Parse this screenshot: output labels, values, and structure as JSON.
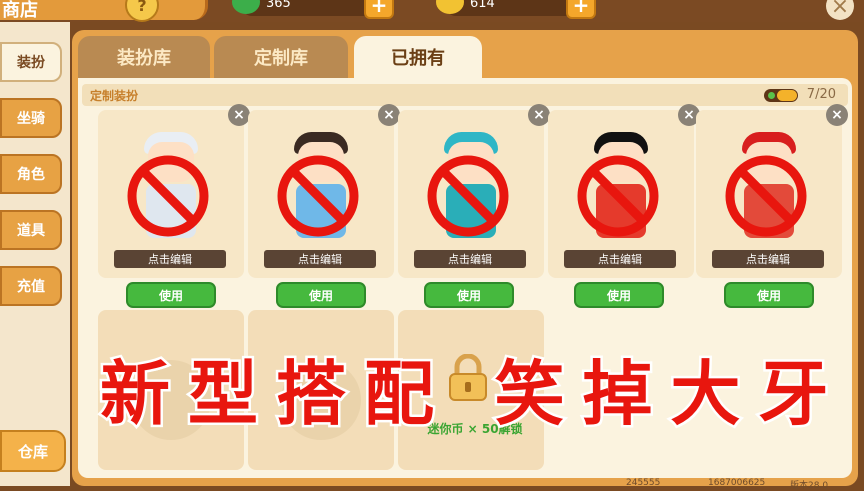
{
  "topbar": {
    "title": "商店",
    "help_icon": "?",
    "currencies": [
      {
        "name": "green-gem",
        "value": "365",
        "color": "#3cae4a"
      },
      {
        "name": "gold-coin",
        "value": "614",
        "color": "#f2c232"
      }
    ],
    "plus_label": "+",
    "close_label": "×"
  },
  "sidebar": {
    "items": [
      {
        "label": "装扮",
        "active": true
      },
      {
        "label": "坐骑",
        "active": false
      },
      {
        "label": "角色",
        "active": false
      },
      {
        "label": "道具",
        "active": false
      },
      {
        "label": "充值",
        "active": false
      }
    ],
    "warehouse_label": "仓库"
  },
  "tabs": [
    {
      "label": "装扮库",
      "active": false
    },
    {
      "label": "定制库",
      "active": false
    },
    {
      "label": "已拥有",
      "active": true
    }
  ],
  "section": {
    "title": "定制装扮",
    "count": "7/20"
  },
  "cards": [
    {
      "edit_label": "点击编辑",
      "use_label": "使用",
      "hair": "#e9eef4",
      "body": "#dfe7ef"
    },
    {
      "edit_label": "点击编辑",
      "use_label": "使用",
      "hair": "#3a2a22",
      "body": "#6fb8e8"
    },
    {
      "edit_label": "点击编辑",
      "use_label": "使用",
      "hair": "#2fb6c6",
      "body": "#2aaeb8"
    },
    {
      "edit_label": "点击编辑",
      "use_label": "使用",
      "hair": "#111111",
      "body": "#e53a2c"
    },
    {
      "edit_label": "点击编辑",
      "use_label": "使用",
      "hair": "#d81e1e",
      "body": "#e34a3a"
    }
  ],
  "delete_label": "×",
  "locked_slot": {
    "unlock_label": "迷你币 × 50解锁"
  },
  "overlay_text": "新型搭配 笑掉大牙",
  "footer": [
    "245555",
    "1687006625",
    "版本28.0"
  ],
  "colors": {
    "accent": "#e39a3b",
    "use_green": "#46b93e",
    "ban_red": "#e8160e"
  }
}
